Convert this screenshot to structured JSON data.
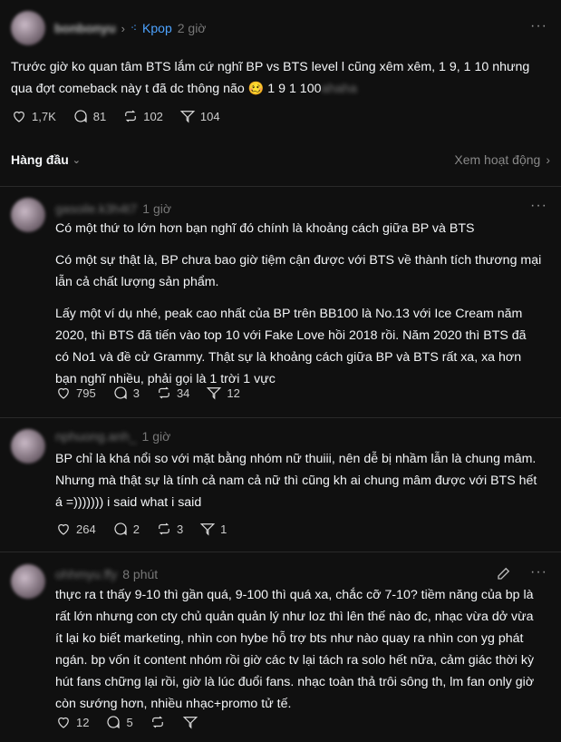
{
  "post": {
    "username": "bonbonyu",
    "separator": "›",
    "topic": "Kpop",
    "time": "2 giờ",
    "text": "Trước giờ ko quan tâm BTS lắm cứ nghĩ BP vs BTS level l cũng xêm xêm, 1 9, 1 10 nhưng qua đợt comeback này t đã dc thông não 🥴  1 9 1 100",
    "text_blur": "ahaha",
    "likes": "1,7K",
    "comments": "81",
    "reposts": "102",
    "shares": "104"
  },
  "sort": {
    "label": "Hàng đầu",
    "activity": "Xem hoạt động"
  },
  "comments": [
    {
      "username": "gasoile.k3h4t7",
      "time": "1 giờ",
      "paragraphs": [
        "Có một thứ to lớn hơn bạn nghĩ đó chính là khoảng cách giữa BP và BTS",
        "Có một sự thật là, BP chưa bao giờ tiệm cận được với BTS về thành tích thương mại lẫn cả chất lượng sản phẩm.",
        "Lấy một ví dụ nhé, peak cao nhất của BP trên BB100 là No.13 với Ice Cream năm 2020, thì BTS đã tiến vào top 10 với Fake Love hồi 2018 rồi. Năm 2020 thì BTS đã có No1 và đề cử Grammy. Thật sự là khoảng cách giữa BP và BTS rất xa, xa hơn bạn nghĩ nhiều, phải gọi là 1 trời 1 vực"
      ],
      "likes": "795",
      "comments": "3",
      "reposts": "34",
      "shares": "12"
    },
    {
      "username": "nphuong.anh_",
      "time": "1 giờ",
      "paragraphs": [
        "BP chỉ là khá nổi so với mặt bằng nhóm nữ thuiii, nên dễ bị nhầm lẫn là chung mâm. Nhưng mà thật sự là tính cả nam cả nữ thì cũng kh ai chung mâm được với BTS hết á =))))))) i said what i said"
      ],
      "likes": "264",
      "comments": "2",
      "reposts": "3",
      "shares": "1"
    },
    {
      "username": "ohhmyu.ffy",
      "time": "8 phút",
      "paragraphs": [
        "thực ra t thấy 9-10 thì gần quá, 9-100 thì quá xa, chắc cỡ 7-10? tiềm năng của bp là rất lớn nhưng con cty chủ quản quản lý như loz thì lên thế nào đc, nhạc vừa dở vừa ít lại ko biết marketing, nhìn con hybe hỗ trợ bts như nào quay ra nhìn con yg phát ngán. bp vốn ít content nhóm rồi giờ các tv lại tách ra solo hết nữa, cảm giác thời kỳ hút fans chững lại rồi, giờ là lúc đuổi fans. nhạc toàn thả trôi sông th, lm fan only giờ còn sướng hơn, nhiều nhạc+promo tử tế."
      ],
      "likes": "12",
      "comments": "5",
      "reposts": "",
      "shares": ""
    }
  ],
  "icons": {
    "heart": "heart-icon",
    "comment": "comment-icon",
    "repost": "repost-icon",
    "share": "share-icon",
    "more": "more-icon",
    "edit": "edit-icon",
    "topic": "topic-icon"
  },
  "colors": {
    "background": "#101010",
    "topic": "#4da3ff",
    "muted": "#777777",
    "divider": "#2a2a2a"
  }
}
